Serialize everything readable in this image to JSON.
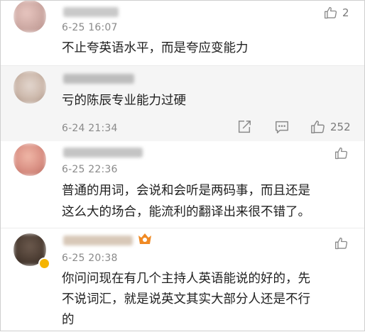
{
  "comments": [
    {
      "time": "6-25 16:07",
      "text_lines": [
        "不止夸英语水平，而是夸应变能力"
      ],
      "like_count": "2"
    },
    {
      "time": "6-24 21:34",
      "text_lines": [
        "亏的陈辰专业能力过硬"
      ],
      "like_count": "252"
    },
    {
      "time": "6-25 22:36",
      "text_lines": [
        "普通的用词，会说和会听是两码事，而且还是",
        "这么大的场合，能流利的翻译出来很不错了。"
      ],
      "like_count": ""
    },
    {
      "time": "6-25 20:38",
      "text_lines": [
        "你问问现在有几个主持人英语能说的好的，先",
        "不说词汇，就是说英文其实大部分人还是不行",
        "的"
      ],
      "like_count": ""
    }
  ],
  "icons": {
    "like": "thumbs-up-icon",
    "share": "share-icon",
    "reply": "comment-icon",
    "badge": "fan-badge-icon",
    "verified": "verified-badge-icon"
  },
  "colors": {
    "icon_gray": "#8a8a8a",
    "time_gray": "#8a8a8a",
    "highlight_bg": "#f5f5f5",
    "badge_orange": "#f08a24",
    "verified_yellow": "#f5b400"
  }
}
